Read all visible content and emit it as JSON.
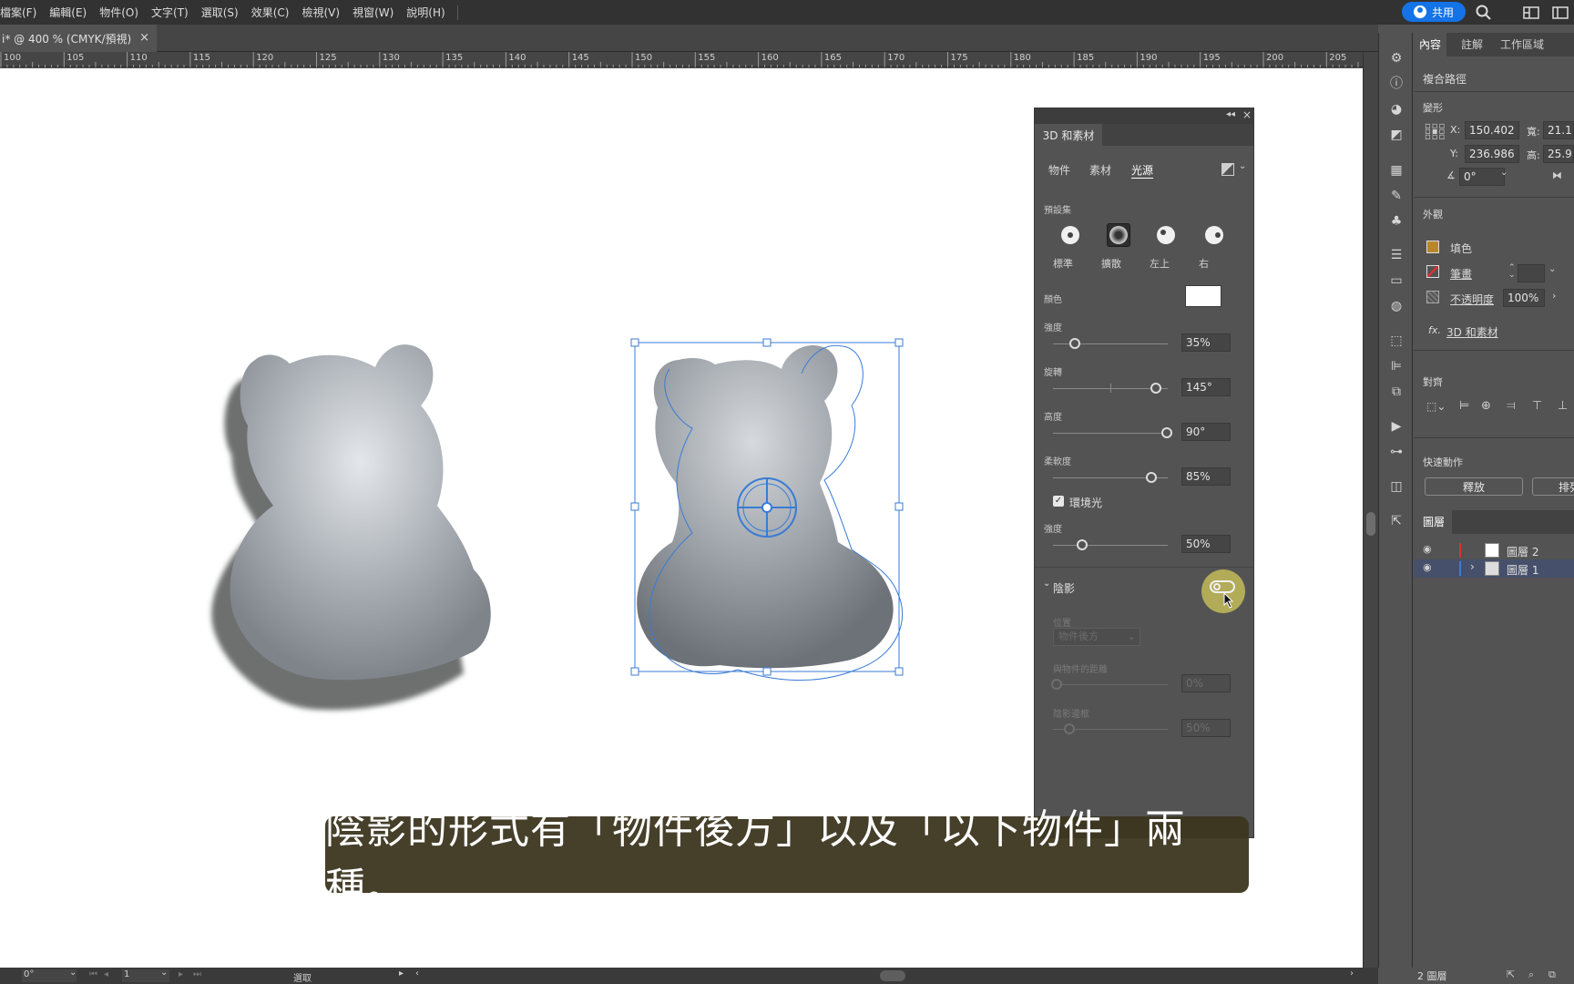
{
  "menu": {
    "items": [
      "檔案(F)",
      "編輯(E)",
      "物件(O)",
      "文字(T)",
      "選取(S)",
      "效果(C)",
      "檢視(V)",
      "視窗(W)",
      "說明(H)"
    ],
    "share_label": "共用"
  },
  "document": {
    "tab_title": "i* @ 400 % (CMYK/預視)",
    "close_glyph": "×",
    "ruler_labels": [
      "100",
      "105",
      "110",
      "115",
      "120",
      "125",
      "130",
      "135",
      "140",
      "145",
      "150",
      "155",
      "160",
      "165",
      "170",
      "175",
      "180",
      "185",
      "190",
      "195",
      "200",
      "205"
    ]
  },
  "panel3d": {
    "title": "3D 和素材",
    "subtabs": [
      "物件",
      "素材",
      "光源"
    ],
    "preset_label": "預設集",
    "presets": [
      "標準",
      "擴散",
      "左上",
      "右"
    ],
    "color_label": "顏色",
    "intensity_label": "強度",
    "intensity_value": "35%",
    "intensity_level": 0.35,
    "rotation_label": "旋轉",
    "rotation_value": "145°",
    "height_label": "高度",
    "height_value": "90°",
    "softness_label": "柔軟度",
    "softness_value": "85%",
    "ambient_label": "環境光",
    "ambient_intensity_label": "強度",
    "ambient_intensity_value": "50%",
    "shadow_label": "陰影",
    "position_label": "位置",
    "position_value": "物件後方",
    "distance_label": "與物件的距離",
    "distance_value": "0%",
    "shadow_bound_label": "陰影邊框",
    "shadow_bound_value": "50%"
  },
  "properties": {
    "tabs": [
      "內容",
      "註解",
      "工作區域"
    ],
    "object_type": "複合路徑",
    "transform_label": "變形",
    "x_label": "X:",
    "x_value": "150.402",
    "y_label": "Y:",
    "y_value": "236.986",
    "w_label": "寬:",
    "w_value": "21.1",
    "h_label": "高:",
    "h_value": "25.9",
    "angle_value": "0°",
    "appearance_label": "外觀",
    "fill_label": "填色",
    "stroke_label": "筆畫",
    "opacity_label": "不透明度",
    "opacity_value": "100%",
    "fx_label": "fx.",
    "effect_link": "3D 和素材",
    "align_label": "對齊",
    "quick_actions_label": "快速動作",
    "release_label": "釋放",
    "arrange_label": "排列"
  },
  "layers": {
    "title": "圖層",
    "items": [
      "圖層 2",
      "圖層 1"
    ],
    "count_label": "2 圖層"
  },
  "status": {
    "angle": "0°",
    "artboard": "1",
    "tool": "選取"
  },
  "subtitle": "陰影的形式有「物件後方」以及「以下物件」兩種。",
  "colors": {
    "accent": "#1473e6",
    "selection": "#3a7bd5",
    "fill_swatch": "#b8862b",
    "stroke_swatch": "#e03030"
  }
}
